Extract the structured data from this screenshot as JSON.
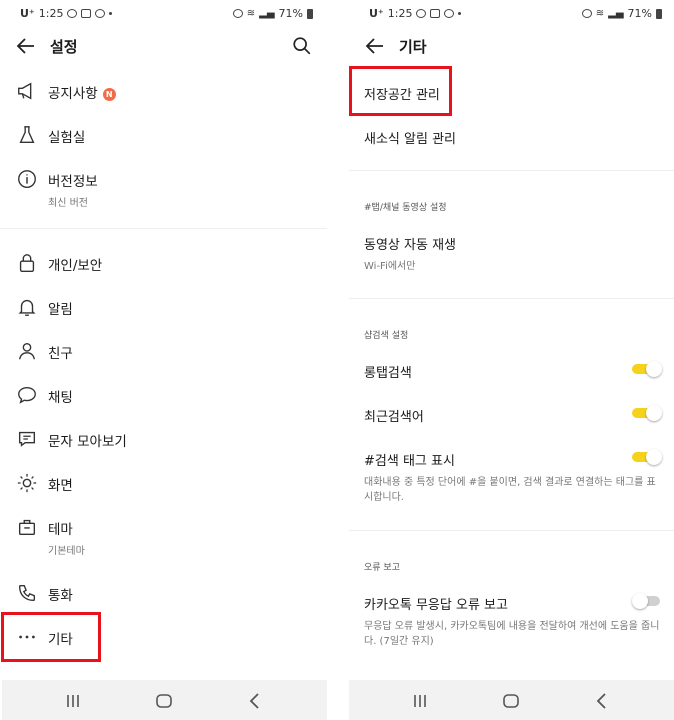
{
  "status": {
    "carrier": "U⁺",
    "time": "1:25",
    "battery": "71%"
  },
  "left": {
    "title": "설정",
    "items": [
      {
        "label": "공지사항",
        "badge": "N"
      },
      {
        "label": "실험실"
      },
      {
        "label": "버전정보",
        "sub": "최신 버전"
      },
      {
        "label": "개인/보안"
      },
      {
        "label": "알림"
      },
      {
        "label": "친구"
      },
      {
        "label": "채팅"
      },
      {
        "label": "문자 모아보기"
      },
      {
        "label": "화면"
      },
      {
        "label": "테마",
        "sub": "기본테마"
      },
      {
        "label": "통화"
      },
      {
        "label": "기타"
      }
    ]
  },
  "right": {
    "title": "기타",
    "storage": "저장공간 관리",
    "news_alert": "새소식 알림 관리",
    "section_video": "#탭/채널 동영상 설정",
    "video_autoplay": "동영상 자동 재생",
    "video_autoplay_sub": "Wi-Fi에서만",
    "section_search": "샵검색 설정",
    "long_tab_search": "롱탭검색",
    "recent_search": "최근검색어",
    "search_tag": "#검색 태그 표시",
    "search_tag_sub": "대화내용 중 특정 단어에 #을 붙이면, 검색 결과로 연결하는 태그를 표시합니다.",
    "section_error": "오류 보고",
    "no_response_report": "카카오톡 무응답 오류 보고",
    "no_response_sub": "무응답 오류 발생시, 카카오톡팀에 내용을 전달하여 개선에 도움을 줍니다. (7일간 유지)",
    "toggles": {
      "long_tab_search": true,
      "recent_search": true,
      "search_tag": true,
      "no_response_report": false
    }
  },
  "colors": {
    "toggle_on": "#f7d21b",
    "toggle_off": "#d0d0d0",
    "highlight": "#e8121c",
    "badge": "#f06b47"
  }
}
